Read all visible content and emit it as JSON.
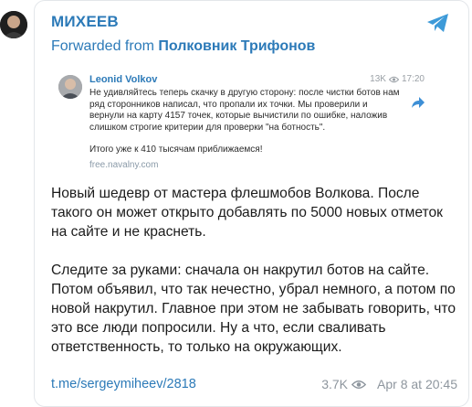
{
  "channel": {
    "name": "МИХЕЕВ",
    "forwarded_prefix": "Forwarded from",
    "forwarded_source": "Полковник Трифонов"
  },
  "embed": {
    "author": "Leonid Volkov",
    "views": "13K",
    "time": "17:20",
    "paragraph1": "Не удивляйтесь теперь скачку в другую сторону: после чистки ботов нам ряд сторонников написал, что пропали их точки. Мы проверили и вернули на карту 4157 точек, которые вычистили по ошибке, наложив слишком строгие критерии для проверки \"на ботность\".",
    "paragraph2": "Итого уже к 410 тысячам приближаемся!",
    "link": "free.navalny.com"
  },
  "message": {
    "paragraph1": "Новый шедевр от мастера флешмобов Волкова. После такого он может открыто добавлять по 5000 новых отметок на сайте и не краснеть.",
    "paragraph2": "Следите за руками: сначала он накрутил ботов на сайте. Потом объявил, что так нечестно, убрал немного, а потом по новой накрутил. Главное при этом не забывать говорить, что это все люди попросили. Ну а что, если сваливать ответственность, то только на окружающих."
  },
  "footer": {
    "post_link": "t.me/sergeymiheev/2818",
    "views": "3.7K",
    "date": "Apr 8 at 20:45"
  },
  "colors": {
    "accent": "#2c7ab8",
    "muted": "#8e969e",
    "border": "#e3e6ea"
  },
  "icons": {
    "share": "telegram-share-icon",
    "views": "eye-icon",
    "forward": "forward-arrow-icon"
  }
}
